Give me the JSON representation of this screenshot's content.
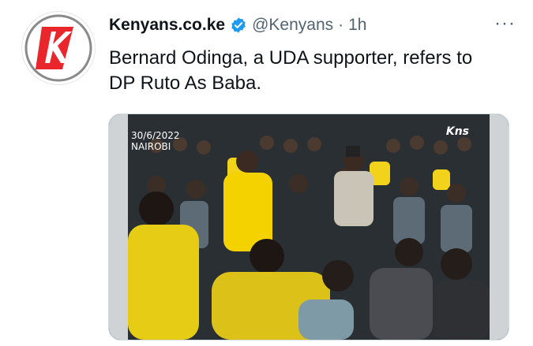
{
  "tweet": {
    "display_name": "Kenyans.co.ke",
    "handle": "@Kenyans",
    "separator": "·",
    "time": "1h",
    "more_label": "···",
    "text": "Bernard Odinga, a UDA supporter, refers to\nDP Ruto As Baba.",
    "avatar_letter": "K"
  },
  "media": {
    "date_overlay": "30/6/2022",
    "location_overlay": "NAIROBI",
    "logo_overlay": "Kns"
  },
  "colors": {
    "verified_blue": "#1d9bf0",
    "brand_red": "#e8262b",
    "text_primary": "#0f1419",
    "text_secondary": "#536471",
    "crowd_yellow": "#f4d200"
  }
}
